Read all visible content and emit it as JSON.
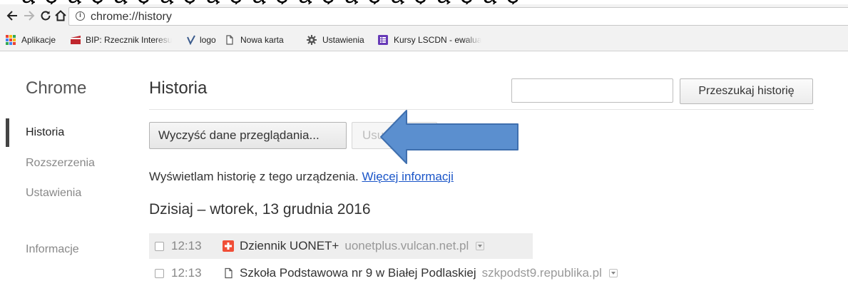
{
  "browser": {
    "url": "chrome://history",
    "nav": {
      "back_icon": "back-arrow-icon",
      "forward_icon": "forward-arrow-icon",
      "reload_icon": "reload-icon",
      "home_icon": "home-icon",
      "info_icon": "info-icon"
    }
  },
  "bookmarks": [
    {
      "label": "Aplikacje",
      "icon": "apps-grid-icon"
    },
    {
      "label": "BIP: Rzecznik Interesu",
      "icon": "bip-icon"
    },
    {
      "label": "logo",
      "icon": "v-logo-icon"
    },
    {
      "label": "Nowa karta",
      "icon": "page-icon"
    },
    {
      "label": "Ustawienia",
      "icon": "gear-icon"
    },
    {
      "label": "Kursy LSCDN - ewalua",
      "icon": "form-icon"
    }
  ],
  "sidebar": {
    "title": "Chrome",
    "items": [
      {
        "label": "Historia",
        "active": true
      },
      {
        "label": "Rozszerzenia",
        "active": false
      },
      {
        "label": "Ustawienia",
        "active": false
      },
      {
        "label": "Informacje",
        "active": false
      }
    ]
  },
  "main": {
    "title": "Historia",
    "search_button": "Przeszukaj historię",
    "search_placeholder": "",
    "clear_button": "Wyczyść dane przeglądania...",
    "remove_button": "Usuń",
    "info_text": "Wyświetlam historię z tego urządzenia.",
    "info_link": "Więcej informacji",
    "day_heading": "Dzisiaj – wtorek, 13 grudnia 2016",
    "entries": [
      {
        "time": "12:13",
        "title": "Dziennik UONET+",
        "domain": "uonetplus.vulcan.net.pl",
        "icon": "uonet-icon"
      },
      {
        "time": "12:13",
        "title": "Szkoła Podstawowa nr 9 w Białej Podlaskiej",
        "domain": "szkpodst9.republika.pl",
        "icon": "page-icon"
      }
    ]
  },
  "annotation": {
    "arrow_color": "#5b8fcf",
    "arrow_icon": "left-pointing-arrow"
  }
}
